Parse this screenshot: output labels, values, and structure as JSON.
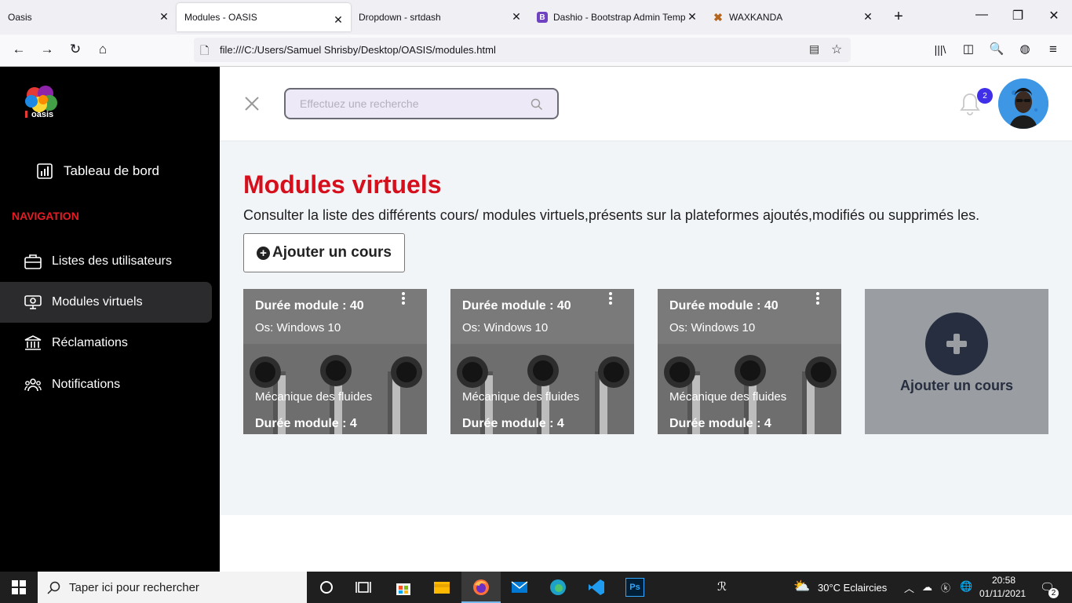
{
  "browser": {
    "tabs": [
      {
        "title": "Oasis"
      },
      {
        "title": "Modules - OASIS"
      },
      {
        "title": "Dropdown - srtdash"
      },
      {
        "title": "Dashio - Bootstrap Admin Temp"
      },
      {
        "title": "WAXKANDA"
      }
    ],
    "url": "file:///C:/Users/Samuel Shrisby/Desktop/OASIS/modules.html"
  },
  "sidebar": {
    "logo_text": "oasis",
    "dashboard_label": "Tableau de bord",
    "section_label": "NAVIGATION",
    "items": [
      {
        "label": "Listes des utilisateurs",
        "icon": "briefcase-icon"
      },
      {
        "label": "Modules virtuels",
        "icon": "projector-icon"
      },
      {
        "label": "Réclamations",
        "icon": "bank-icon"
      },
      {
        "label": "Notifications",
        "icon": "users-icon"
      }
    ]
  },
  "header": {
    "search_placeholder": "Effectuez une recherche",
    "notification_count": "2"
  },
  "main": {
    "title": "Modules virtuels",
    "subtitle": "Consulter la liste des différents cours/ modules virtuels,présents sur la plateformes ajoutés,modifiés ou supprimés les.",
    "add_button_label": "Ajouter un cours",
    "cards": [
      {
        "duration": "Durée module : 40",
        "os": "Os: Windows 10",
        "name": "Mécanique des fluides",
        "footer": "Durée module : 4"
      },
      {
        "duration": "Durée module : 40",
        "os": "Os: Windows 10",
        "name": "Mécanique des fluides",
        "footer": "Durée module : 4"
      },
      {
        "duration": "Durée module : 40",
        "os": "Os: Windows 10",
        "name": "Mécanique des fluides",
        "footer": "Durée module : 4"
      }
    ],
    "add_card_label": "Ajouter un cours"
  },
  "taskbar": {
    "search_text": "Taper ici pour rechercher",
    "weather": "30°C  Eclaircies",
    "time": "20:58",
    "date": "01/11/2021",
    "notif_count": "2"
  },
  "colors": {
    "accent_red": "#d60f1c",
    "sidebar_bg": "#000000",
    "active_item": "#2b2b2e",
    "badge": "#3f2fe8"
  }
}
